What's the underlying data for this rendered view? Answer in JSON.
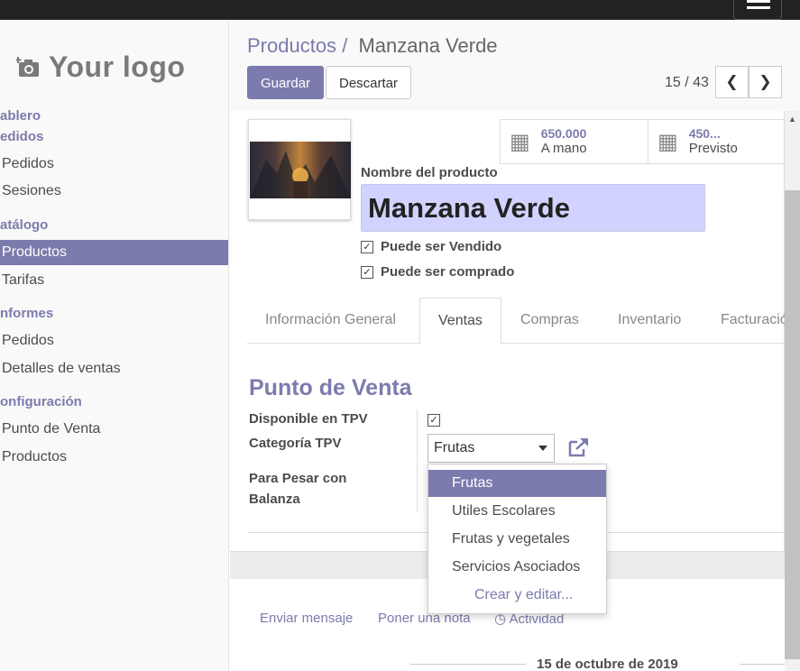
{
  "logo": {
    "text": "Your logo",
    "icon": "camera-plus-icon"
  },
  "sidebar": {
    "sections": [
      {
        "label": "ablero",
        "items": []
      },
      {
        "label": "edidos",
        "items": [
          {
            "label": "Pedidos"
          },
          {
            "label": "Sesiones"
          }
        ]
      },
      {
        "label": "atálogo",
        "items": [
          {
            "label": "Productos",
            "active": true
          },
          {
            "label": "Tarifas"
          }
        ]
      },
      {
        "label": "nformes",
        "items": [
          {
            "label": "Pedidos"
          },
          {
            "label": "Detalles de ventas"
          }
        ]
      },
      {
        "label": "onfiguración",
        "items": [
          {
            "label": "Punto de Venta"
          },
          {
            "label": "Productos"
          }
        ]
      }
    ]
  },
  "header": {
    "breadcrumb_parent": "Productos",
    "breadcrumb_sep": "/",
    "breadcrumb_current": "Manzana Verde",
    "save_label": "Guardar",
    "discard_label": "Descartar",
    "pager": "15 / 43"
  },
  "stats": [
    {
      "value": "650.000",
      "label": "A mano",
      "icon": "building-icon"
    },
    {
      "value": "450...",
      "label": "Previsto",
      "icon": "building-icon"
    }
  ],
  "product": {
    "name_label": "Nombre del producto",
    "name": "Manzana Verde",
    "can_be_sold_label": "Puede ser Vendido",
    "can_be_sold": true,
    "can_be_purchased_label": "Puede ser comprado",
    "can_be_purchased": true
  },
  "tabs": [
    {
      "label": "Información General"
    },
    {
      "label": "Ventas",
      "active": true
    },
    {
      "label": "Compras"
    },
    {
      "label": "Inventario"
    },
    {
      "label": "Facturación"
    }
  ],
  "pos": {
    "section_title": "Punto de Venta",
    "available_label": "Disponible en TPV",
    "available": true,
    "category_label": "Categoría TPV",
    "category_value": "Frutas",
    "scale_label_1": "Para Pesar con",
    "scale_label_2": "Balanza",
    "dropdown_options": [
      "Frutas",
      "Utiles Escolares",
      "Frutas y vegetales",
      "Servicios Asociados"
    ],
    "dropdown_highlighted": "Frutas",
    "create_edit_label": "Crear y editar..."
  },
  "chatter": {
    "send_message": "Enviar mensaje",
    "log_note": "Poner una nota",
    "activity": "Actividad",
    "date": "15 de octubre de 2019"
  },
  "colors": {
    "brand": "#7c7bad",
    "name_bg": "#d2d2ff",
    "topbar": "#222222"
  }
}
